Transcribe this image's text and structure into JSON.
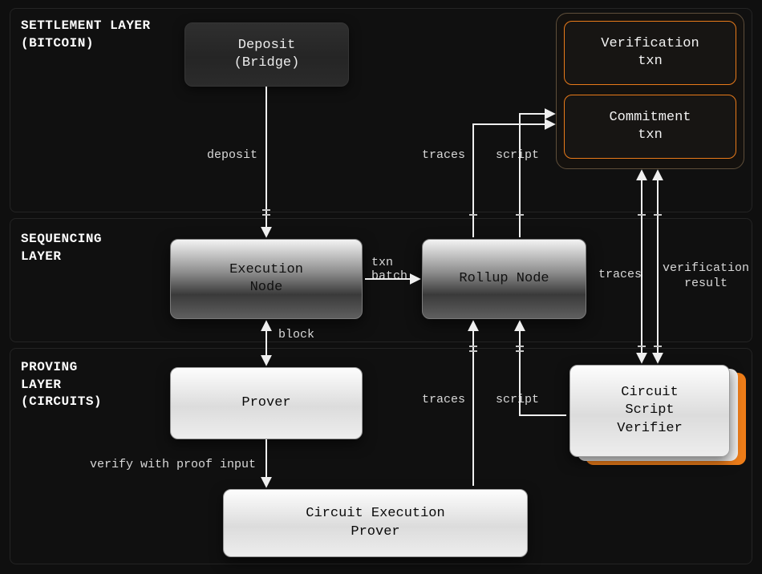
{
  "layers": {
    "settlement": "SETTLEMENT LAYER\n(BITCOIN)",
    "sequencing": "SEQUENCING\nLAYER",
    "proving": "PROVING\nLAYER\n(CIRCUITS)"
  },
  "nodes": {
    "deposit": "Deposit\n(Bridge)",
    "verification_txn": "Verification\ntxn",
    "commitment_txn": "Commitment\ntxn",
    "execution_node": "Execution\nNode",
    "rollup_node": "Rollup Node",
    "prover": "Prover",
    "circuit_verifier": "Circuit\nScript\nVerifier",
    "circuit_exec_prover": "Circuit Execution\nProver"
  },
  "edges": {
    "deposit": "deposit",
    "txn_batch": "txn\nbatch",
    "block": "block",
    "verify_proof": "verify with proof input",
    "traces": "traces",
    "script": "script",
    "verification_result": "verification\nresult"
  }
}
